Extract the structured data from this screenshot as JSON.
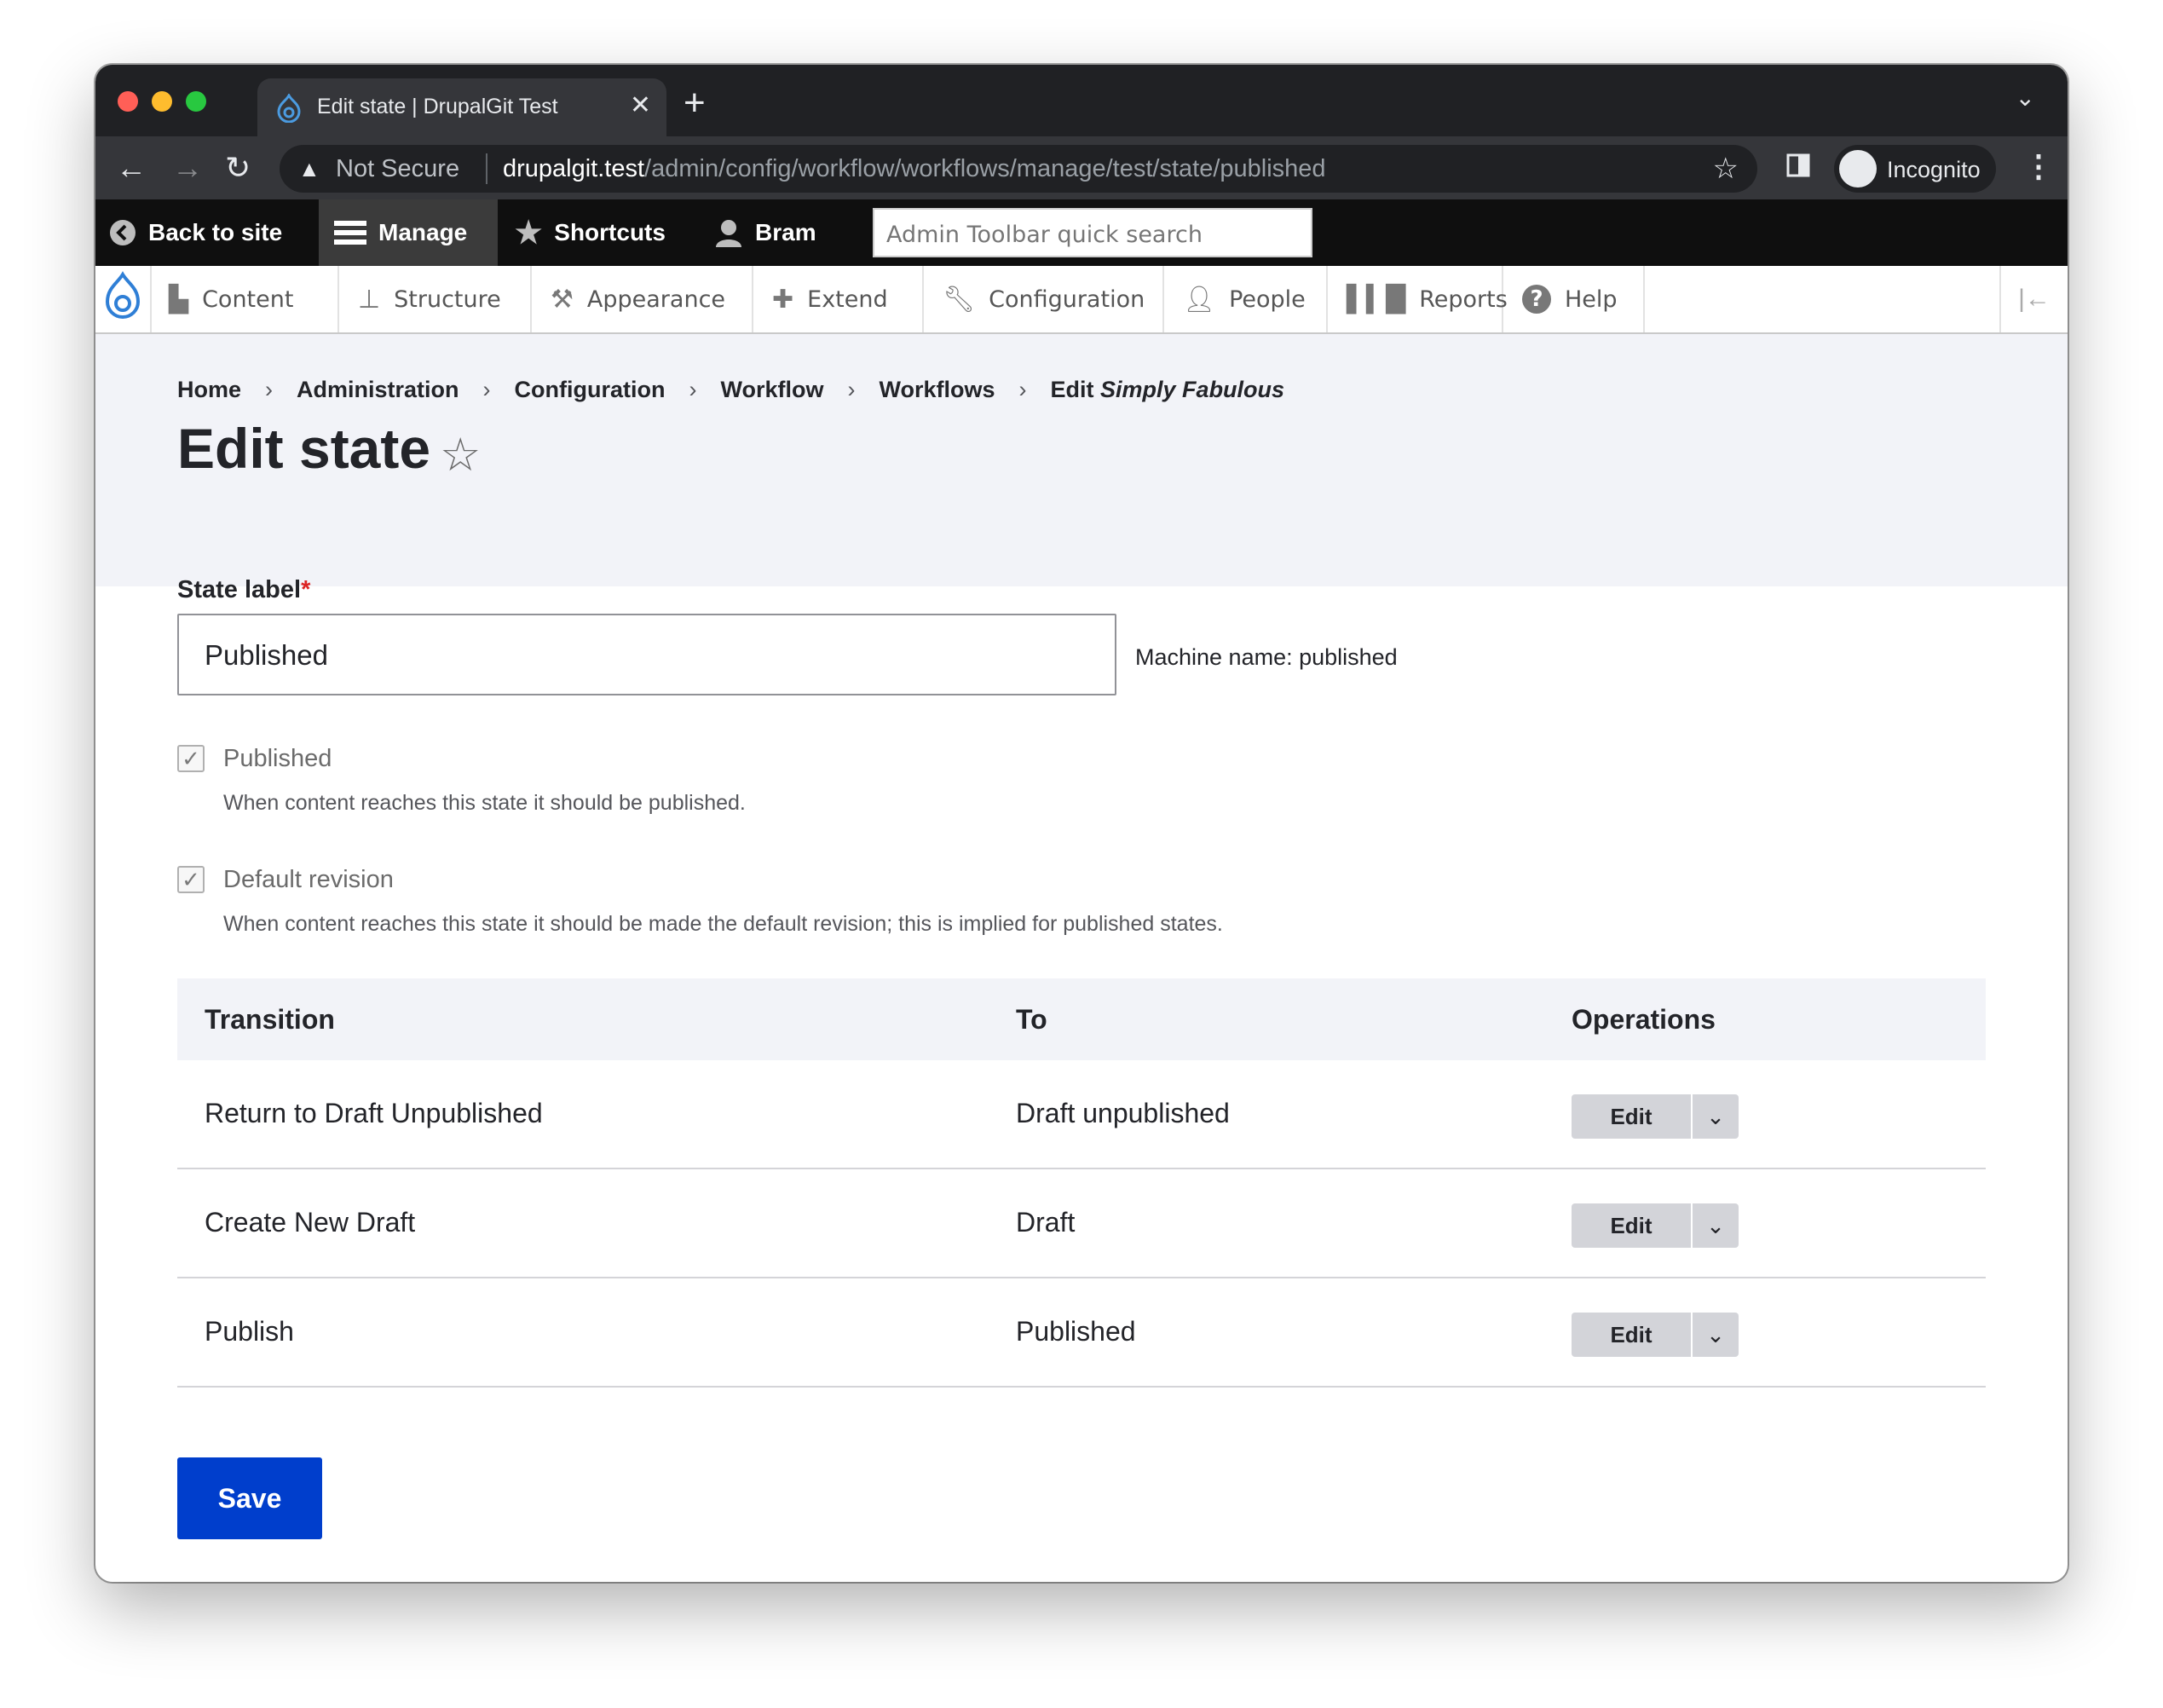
{
  "browser": {
    "tab_title": "Edit state | DrupalGit Test",
    "new_tab_label": "+",
    "security_label": "Not Secure",
    "url_host": "drupalgit.test",
    "url_path": "/admin/config/workflow/workflows/manage/test/state/published",
    "profile_label": "Incognito"
  },
  "toolbar": {
    "back_label": "Back to site",
    "manage_label": "Manage",
    "shortcuts_label": "Shortcuts",
    "user_label": "Bram",
    "search_placeholder": "Admin Toolbar quick search"
  },
  "tray": {
    "items": [
      {
        "label": "Content",
        "icon": "content-icon"
      },
      {
        "label": "Structure",
        "icon": "structure-icon"
      },
      {
        "label": "Appearance",
        "icon": "appearance-icon"
      },
      {
        "label": "Extend",
        "icon": "extend-icon"
      },
      {
        "label": "Configuration",
        "icon": "configuration-icon"
      },
      {
        "label": "People",
        "icon": "people-icon"
      },
      {
        "label": "Reports",
        "icon": "reports-icon"
      },
      {
        "label": "Help",
        "icon": "help-icon"
      }
    ]
  },
  "breadcrumb": {
    "items": [
      "Home",
      "Administration",
      "Configuration",
      "Workflow",
      "Workflows"
    ],
    "last_prefix": "Edit",
    "last_name": "Simply Fabulous"
  },
  "page": {
    "title": "Edit state"
  },
  "form": {
    "state_label": "State label",
    "required_marker": "*",
    "state_value": "Published",
    "machine_name": "Machine name: published",
    "published_label": "Published",
    "published_desc": "When content reaches this state it should be published.",
    "published_checked": true,
    "default_label": "Default revision",
    "default_desc": "When content reaches this state it should be made the default revision; this is implied for published states.",
    "default_checked": true
  },
  "table": {
    "headers": [
      "Transition",
      "To",
      "Operations"
    ],
    "rows": [
      {
        "transition": "Return to Draft Unpublished",
        "to": "Draft unpublished",
        "op": "Edit"
      },
      {
        "transition": "Create New Draft",
        "to": "Draft",
        "op": "Edit"
      },
      {
        "transition": "Publish",
        "to": "Published",
        "op": "Edit"
      }
    ]
  },
  "actions": {
    "save_label": "Save"
  },
  "colors": {
    "primary": "#003ecc",
    "toolbar_bg": "#0f0f0f",
    "header_bg": "#f2f3f8",
    "required": "#dc2323"
  }
}
